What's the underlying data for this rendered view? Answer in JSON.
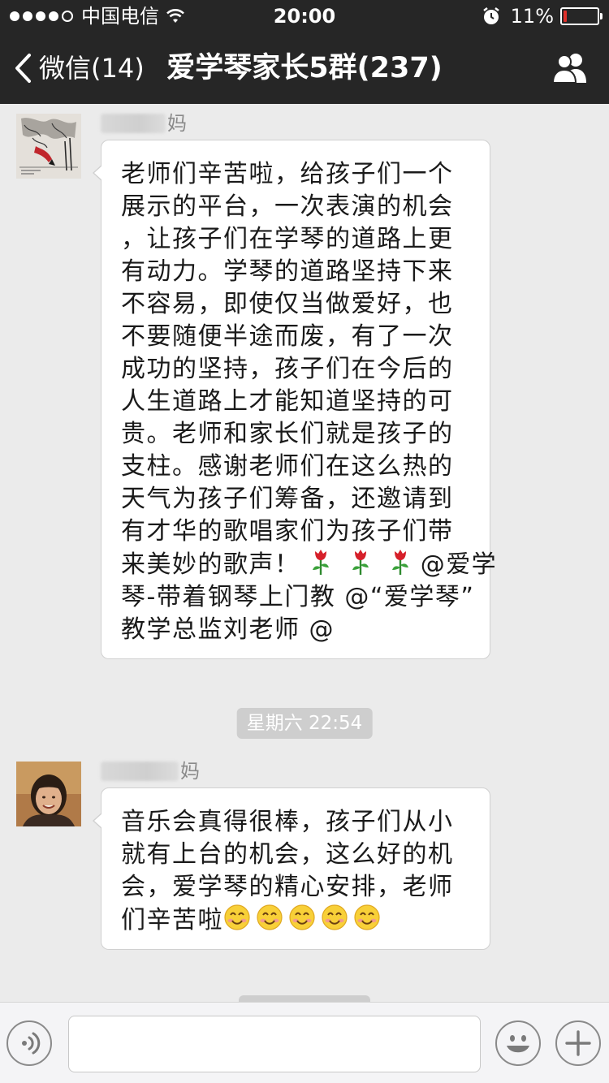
{
  "status_bar": {
    "carrier": "中国电信",
    "time": "20:00",
    "battery_percent": "11%",
    "battery_level": 0.11,
    "signal_bars_filled": 4,
    "signal_bars_total": 5,
    "icons": [
      "wifi-icon",
      "alarm-icon",
      "battery-icon"
    ]
  },
  "nav": {
    "back_label": "微信(14)",
    "title": "爱学琴家长5群(237)",
    "back_icon": "chevron-left-icon",
    "members_icon": "group-members-icon"
  },
  "messages": [
    {
      "sender_suffix": "妈",
      "lines": [
        "老师们辛苦啦，给孩子们一个",
        "展示的平台，一次表演的机会",
        "，让孩子们在学琴的道路上更",
        "有动力。学琴的道路坚持下来",
        "不容易，即使仅当做爱好，也",
        "不要随便半途而废，有了一次",
        "成功的坚持，孩子们在今后的",
        "人生道路上才能知道坚持的可",
        "贵。老师和家长们就是孩子的",
        "支柱。感谢老师们在这么热的",
        "天气为孩子们筹备，还邀请到",
        "有才华的歌唱家们为孩子们带",
        "来美妙的歌声！",
        "@爱学",
        "琴-带着钢琴上门教 @“爱学琴”",
        "教学总监刘老师 @"
      ],
      "emoji": "rose-emoji",
      "emoji_count": 3
    },
    {
      "sender_suffix": "妈",
      "lines": [
        "音乐会真得很棒，孩子们从小",
        "就有上台的机会，这么好的机",
        "会，爱学琴的精心安排，老师",
        "们辛苦啦"
      ],
      "emoji": "smiling-face-emoji",
      "emoji_count": 5
    }
  ],
  "timestamp": "星期六 22:54",
  "input_bar": {
    "voice_icon": "voice-icon",
    "emoji_icon": "emoji-smile-icon",
    "plus_icon": "plus-icon"
  },
  "colors": {
    "nav_background": "#262626",
    "chat_background": "#ebebeb",
    "bubble_background": "#ffffff",
    "battery_low": "#e0302a",
    "timestamp_pill": "#cecece"
  }
}
